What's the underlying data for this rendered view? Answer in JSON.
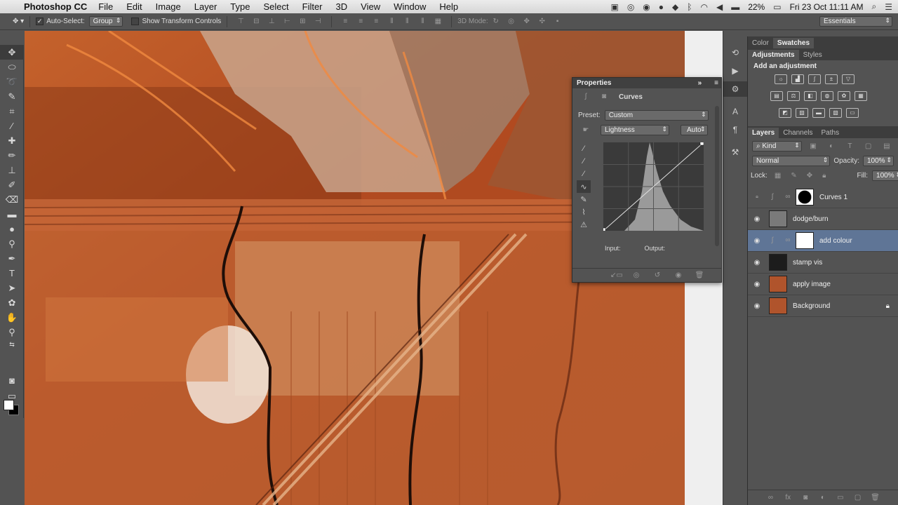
{
  "menubar": {
    "app_name": "Photoshop CC",
    "menus": [
      "File",
      "Edit",
      "Image",
      "Layer",
      "Type",
      "Select",
      "Filter",
      "3D",
      "View",
      "Window",
      "Help"
    ],
    "battery": "22%",
    "datetime": "Fri 23 Oct  11:11 AM"
  },
  "options": {
    "auto_select_label": "Auto-Select:",
    "auto_select_value": "Group",
    "transform_label": "Show Transform Controls",
    "mode_3d_label": "3D Mode:",
    "workspace": "Essentials"
  },
  "properties": {
    "title": "Properties",
    "panel_name": "Curves",
    "preset_label": "Preset:",
    "preset_value": "Custom",
    "channel_value": "Lightness",
    "auto_label": "Auto",
    "input_label": "Input:",
    "output_label": "Output:"
  },
  "right_panel": {
    "top_tabs": [
      "Color",
      "Swatches"
    ],
    "adj_tabs": [
      "Adjustments",
      "Styles"
    ],
    "adj_heading": "Add an adjustment",
    "layer_tabs": [
      "Layers",
      "Channels",
      "Paths"
    ],
    "kind_filter": "Kind",
    "blend_mode": "Normal",
    "opacity_label": "Opacity:",
    "opacity_value": "100%",
    "lock_label": "Lock:",
    "fill_label": "Fill:",
    "fill_value": "100%"
  },
  "layers": [
    {
      "name": "Curves 1",
      "visible": false,
      "type": "adjustment",
      "selected": false
    },
    {
      "name": "dodge/burn",
      "visible": true,
      "type": "gray",
      "selected": false
    },
    {
      "name": "add colour",
      "visible": true,
      "type": "adjustment",
      "selected": true
    },
    {
      "name": "stamp vis",
      "visible": true,
      "type": "dark",
      "selected": false
    },
    {
      "name": "apply image",
      "visible": true,
      "type": "image",
      "selected": false
    },
    {
      "name": "Background",
      "visible": true,
      "type": "image",
      "selected": false,
      "locked": true
    }
  ],
  "colors": {
    "selection": "#5f7596",
    "panel": "#535353",
    "canvas_base": "#b5522a"
  }
}
